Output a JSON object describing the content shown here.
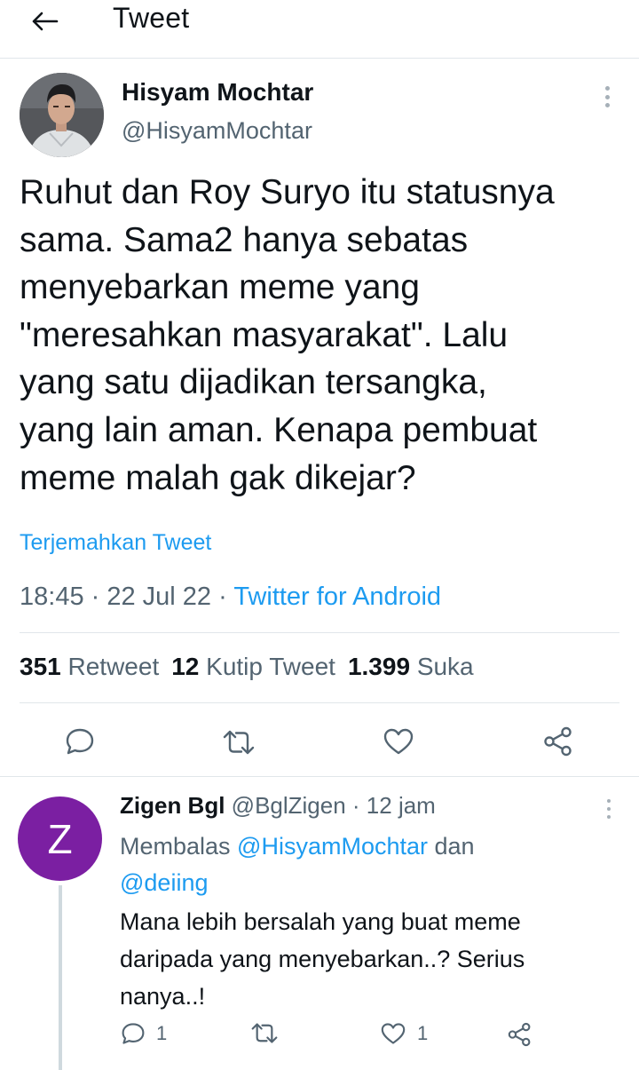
{
  "topbar": {
    "title": "Tweet"
  },
  "author": {
    "name": "Hisyam Mochtar",
    "handle": "@HisyamMochtar"
  },
  "tweet": {
    "lines": [
      "Ruhut dan Roy Suryo itu statusnya",
      "sama. Sama2 hanya sebatas",
      "menyebarkan meme yang",
      "\"meresahkan masyarakat\". Lalu",
      "yang satu dijadikan tersangka,",
      "yang lain aman. Kenapa pembuat",
      "meme malah gak dikejar?"
    ],
    "translate": "Terjemahkan Tweet",
    "time": "18:45",
    "date": "22 Jul 22",
    "separator": " · ",
    "source": "Twitter for Android"
  },
  "stats": {
    "retweets_count": "351",
    "retweets_label": "Retweet",
    "quotes_count": "12",
    "quotes_label": "Kutip Tweet",
    "likes_count": "1.399",
    "likes_label": "Suka"
  },
  "reply": {
    "avatar_letter": "Z",
    "avatar_color": "#7b1fa2",
    "name": "Zigen Bgl",
    "handle": "@BglZigen",
    "time": "12 jam",
    "replying_prefix": "Membalas ",
    "replying_user1": "@HisyamMochtar",
    "replying_conj": " dan ",
    "replying_user2": "@deiing",
    "lines": [
      "Mana lebih bersalah yang buat meme",
      "daripada yang menyebarkan..? Serius",
      "nanya..!"
    ],
    "reply_count": "1",
    "like_count": "1"
  },
  "icons": {
    "back": "arrow-left-icon",
    "more": "more-vertical-icon",
    "reply": "comment-icon",
    "retweet": "retweet-icon",
    "like": "heart-icon",
    "share": "share-icon"
  },
  "colors": {
    "accent": "#1d9bf0",
    "muted": "#536471",
    "text": "#0f1419"
  }
}
